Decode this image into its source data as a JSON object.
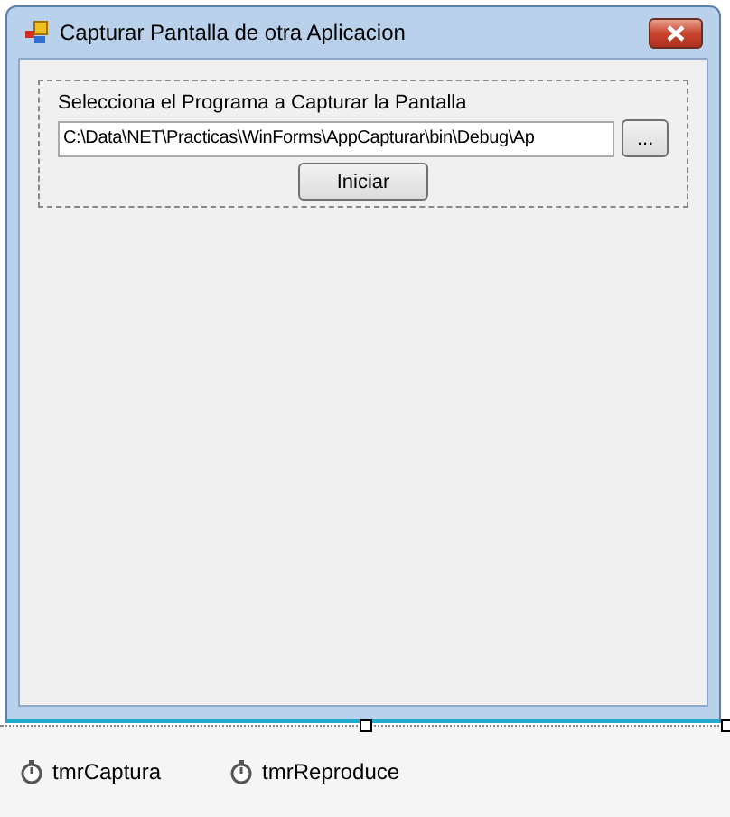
{
  "window": {
    "title": "Capturar Pantalla de otra Aplicacion"
  },
  "group": {
    "label": "Selecciona el Programa a Capturar la Pantalla",
    "path": "C:\\Data\\NET\\Practicas\\WinForms\\AppCapturar\\bin\\Debug\\Ap",
    "browse_button": "...",
    "start_button": "Iniciar"
  },
  "component_tray": [
    "tmrCaptura",
    "tmrReproduce"
  ]
}
